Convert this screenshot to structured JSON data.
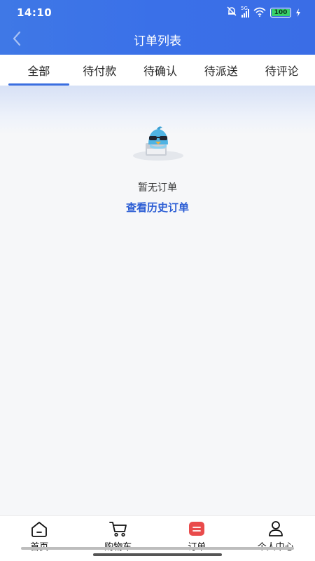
{
  "status_bar": {
    "time": "14:10",
    "network": "5G",
    "battery": "100",
    "battery_color": "#38d16a"
  },
  "header": {
    "title": "订单列表",
    "back_icon": "chevron-left-icon",
    "gradient_color": "#3a70e8"
  },
  "tabs": [
    {
      "label": "全部",
      "active": true
    },
    {
      "label": "待付款",
      "active": false
    },
    {
      "label": "待确认",
      "active": false
    },
    {
      "label": "待派送",
      "active": false
    },
    {
      "label": "待评论",
      "active": false
    }
  ],
  "empty_state": {
    "illustration": "mascot-penguin-with-sunglasses",
    "message": "暂无订单",
    "link_label": "查看历史订单",
    "link_color": "#2b5dd4"
  },
  "bottom_nav": [
    {
      "label": "首页",
      "icon": "home-icon",
      "active": false
    },
    {
      "label": "购物车",
      "icon": "cart-icon",
      "active": false
    },
    {
      "label": "订单",
      "icon": "order-icon",
      "active": true
    },
    {
      "label": "个人中心",
      "icon": "user-icon",
      "active": false
    }
  ],
  "colors": {
    "accent": "#3a6ee0",
    "order_icon": "#e94b4b"
  }
}
